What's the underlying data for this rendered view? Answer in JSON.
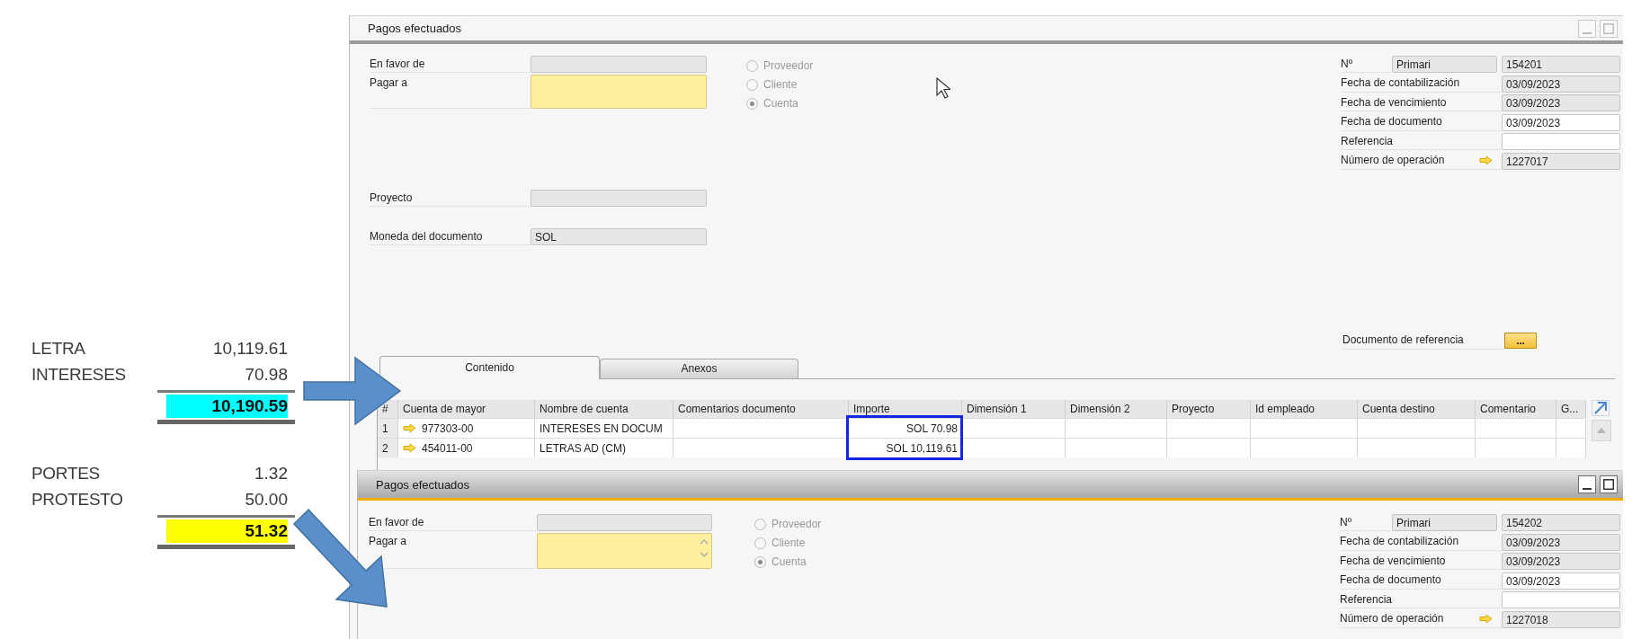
{
  "worksheet": {
    "groups": [
      {
        "items": [
          {
            "label": "LETRA",
            "amount": "10,119.61"
          },
          {
            "label": "INTERESES",
            "amount": "70.98"
          }
        ],
        "total": "10,190.59",
        "color": "#00ffff"
      },
      {
        "items": [
          {
            "label": "PORTES",
            "amount": "1.32"
          },
          {
            "label": "PROTESTO",
            "amount": "50.00"
          }
        ],
        "total": "51.32",
        "color": "#ffff00"
      }
    ]
  },
  "windows": [
    {
      "title": "Pagos efectuados",
      "active": false,
      "left_fields": [
        {
          "label": "En favor de",
          "kind": "readonly"
        },
        {
          "label": "Pagar a",
          "kind": "required",
          "scroll_arrows": false
        },
        {
          "label": "Proyecto",
          "kind": "readonly"
        },
        {
          "label": "Moneda del documento",
          "kind": "readonly",
          "value": "SOL"
        }
      ],
      "radios": [
        {
          "label": "Proveedor",
          "selected": false
        },
        {
          "label": "Cliente",
          "selected": false
        },
        {
          "label": "Cuenta",
          "selected": true
        }
      ],
      "right_fields": [
        {
          "label": "Nº",
          "series": "Primari",
          "value": "154201",
          "kind": "readonly",
          "link": false
        },
        {
          "label": "Fecha de contabilización",
          "value": "03/09/2023",
          "kind": "readonly",
          "link": false
        },
        {
          "label": "Fecha de vencimiento",
          "value": "03/09/2023",
          "kind": "readonly",
          "link": false
        },
        {
          "label": "Fecha de documento",
          "value": "03/09/2023",
          "kind": "editable",
          "link": false
        },
        {
          "label": "Referencia",
          "kind": "editable",
          "link": false
        },
        {
          "label": "Número de operación",
          "value": "1227017",
          "kind": "readonly",
          "link": true
        }
      ],
      "reference_document": {
        "label": "Documento de referencia",
        "button": "..."
      },
      "tabs": [
        {
          "label": "Contenido",
          "selected": true
        },
        {
          "label": "Anexos",
          "selected": false
        }
      ],
      "table": {
        "columns": [
          "#",
          "Cuenta de mayor",
          "Nombre de cuenta",
          "Comentarios documento",
          "Importe",
          "Dimensión 1",
          "Dimensión 2",
          "Proyecto",
          "Id empleado",
          "Cuenta destino",
          "Comentario",
          "G..."
        ],
        "rows": [
          {
            "number": "1",
            "account": "977303-00",
            "account_name": "INTERESES EN DOCUM",
            "amount": "SOL 70.98"
          },
          {
            "number": "2",
            "account": "454011-00",
            "account_name": "LETRAS AD (CM)",
            "amount": "SOL 10,119.61"
          }
        ]
      }
    },
    {
      "title": "Pagos efectuados",
      "active": true,
      "left_fields": [
        {
          "label": "En favor de",
          "kind": "readonly"
        },
        {
          "label": "Pagar a",
          "kind": "required",
          "scroll_arrows": true
        }
      ],
      "radios": [
        {
          "label": "Proveedor",
          "selected": false
        },
        {
          "label": "Cliente",
          "selected": false
        },
        {
          "label": "Cuenta",
          "selected": true
        }
      ],
      "right_fields": [
        {
          "label": "Nº",
          "series": "Primari",
          "value": "154202",
          "kind": "readonly",
          "link": false
        },
        {
          "label": "Fecha de contabilización",
          "value": "03/09/2023",
          "kind": "readonly",
          "link": false
        },
        {
          "label": "Fecha de vencimiento",
          "value": "03/09/2023",
          "kind": "readonly",
          "link": false
        },
        {
          "label": "Fecha de documento",
          "value": "03/09/2023",
          "kind": "editable",
          "link": false
        },
        {
          "label": "Referencia",
          "kind": "editable",
          "link": false
        },
        {
          "label": "Número de operación",
          "value": "1227018",
          "kind": "readonly",
          "link": true
        }
      ]
    }
  ]
}
